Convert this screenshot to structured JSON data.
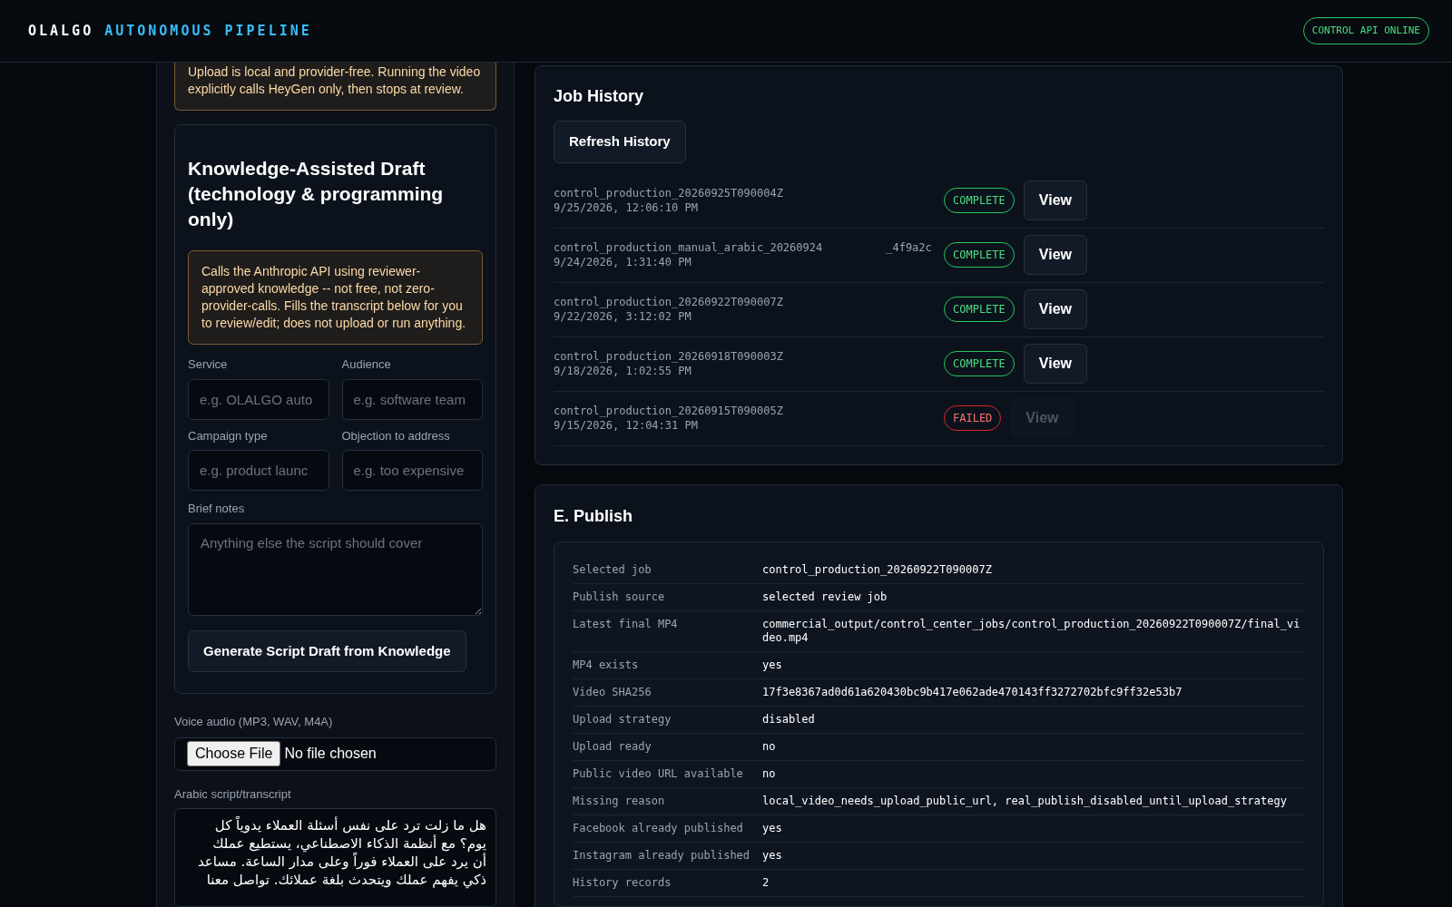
{
  "header": {
    "brand": "OLALGO",
    "subtitle": "AUTONOMOUS PIPELINE",
    "status_badge": "CONTROL API ONLINE"
  },
  "left": {
    "upload_note": "Upload is local and provider-free. Running the video explicitly calls HeyGen only, then stops at review.",
    "knowledge": {
      "title": "Knowledge-Assisted Draft (technology & programming only)",
      "warning": "Calls the Anthropic API using reviewer-approved knowledge -- not free, not zero-provider-calls. Fills the transcript below for you to review/edit; does not upload or run anything.",
      "fields": [
        {
          "label": "Service",
          "placeholder": "e.g. OLALGO auto"
        },
        {
          "label": "Audience",
          "placeholder": "e.g. software team"
        },
        {
          "label": "Campaign type",
          "placeholder": "e.g. product launc"
        },
        {
          "label": "Objection to address",
          "placeholder": "e.g. too expensive"
        }
      ],
      "notes": {
        "label": "Brief notes",
        "placeholder": "Anything else the script should cover"
      },
      "generate_button": "Generate Script Draft from Knowledge"
    },
    "voice_audio": {
      "label": "Voice audio (MP3, WAV, M4A)",
      "button": "Choose File",
      "status": "No file chosen"
    },
    "transcript": {
      "label": "Arabic script/transcript",
      "value": "هل ما زلت ترد على نفس أسئلة العملاء يدوياً كل\nيوم؟ مع أنظمة الذكاء الاصطناعي، يستطيع عملك\nأن يرد على العملاء فوراً وعلى مدار الساعة. مساعد\nذكي يفهم عملك ويتحدث بلغة عملائك. تواصل معنا"
    }
  },
  "job_history": {
    "title": "Job History",
    "refresh_button": "Refresh History",
    "jobs": [
      {
        "id_parts": [
          "control_production_20260925T090004Z"
        ],
        "time": "9/25/2026, 12:06:10 PM",
        "status": "COMPLETE",
        "kind": "complete",
        "view": "View",
        "disabled": false
      },
      {
        "id_parts": [
          "control_production_manual_arabic_20260924",
          "_4f9a2c"
        ],
        "time": "9/24/2026, 1:31:40 PM",
        "status": "COMPLETE",
        "kind": "complete",
        "view": "View",
        "disabled": false
      },
      {
        "id_parts": [
          "control_production_20260922T090007Z"
        ],
        "time": "9/22/2026, 3:12:02 PM",
        "status": "COMPLETE",
        "kind": "complete",
        "view": "View",
        "disabled": false
      },
      {
        "id_parts": [
          "control_production_20260918T090003Z"
        ],
        "time": "9/18/2026, 1:02:55 PM",
        "status": "COMPLETE",
        "kind": "complete",
        "view": "View",
        "disabled": false
      },
      {
        "id_parts": [
          "control_production_20260915T090005Z"
        ],
        "time": "9/15/2026, 12:04:31 PM",
        "status": "FAILED",
        "kind": "failed",
        "view": "View",
        "disabled": true
      }
    ]
  },
  "publish": {
    "title": "E. Publish",
    "rows": [
      {
        "label": "Selected job",
        "value": "control_production_20260922T090007Z"
      },
      {
        "label": "Publish source",
        "value": "selected review job"
      },
      {
        "label": "Latest final MP4",
        "value": "commercial_output/control_center_jobs/control_production_20260922T090007Z/final_video.mp4"
      },
      {
        "label": "MP4 exists",
        "value": "yes"
      },
      {
        "label": "Video SHA256",
        "value": "17f3e8367ad0d61a620430bc9b417e062ade470143ff3272702bfc9ff32e53b7"
      },
      {
        "label": "Upload strategy",
        "value": "disabled"
      },
      {
        "label": "Upload ready",
        "value": "no"
      },
      {
        "label": "Public video URL available",
        "value": "no"
      },
      {
        "label": "Missing reason",
        "value": "local_video_needs_upload_public_url, real_publish_disabled_until_upload_strategy"
      },
      {
        "label": "Facebook already published",
        "value": "yes"
      },
      {
        "label": "Instagram already published",
        "value": "yes"
      },
      {
        "label": "History records",
        "value": "2"
      }
    ]
  }
}
